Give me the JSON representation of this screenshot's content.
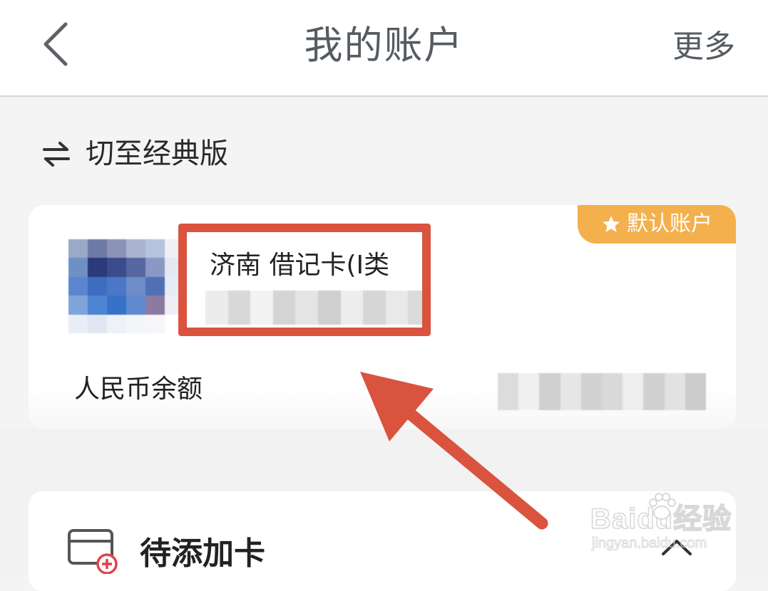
{
  "header": {
    "title": "我的账户",
    "more_label": "更多",
    "back_icon": "chevron-left-icon"
  },
  "switch_version": {
    "label": "切至经典版",
    "icon": "swap-arrows-icon"
  },
  "account_card": {
    "badge_label": "默认账户",
    "badge_icon": "star-icon",
    "card_name": "济南 借记卡(I类",
    "balance_label": "人民币余额",
    "colors": {
      "badge": "#f3b04c",
      "highlight": "#d9533f"
    }
  },
  "pending_section": {
    "title": "待添加卡",
    "icon": "card-add-icon",
    "toggle_icon": "chevron-up-icon"
  },
  "watermark": {
    "brand": "Bai",
    "brand_suffix": "du",
    "cn": "经验",
    "url": "jingyan.baidu.com"
  }
}
